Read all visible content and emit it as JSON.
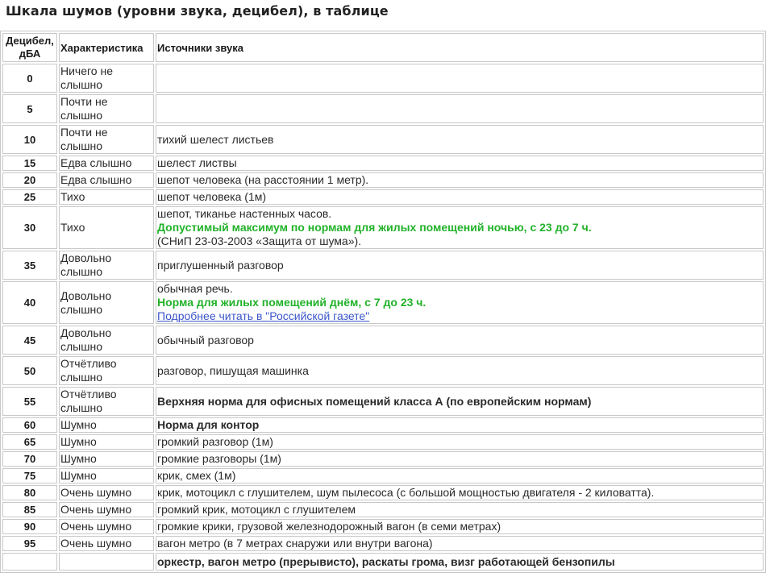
{
  "page": {
    "title": "Шкала шумов (уровни звука, децибел), в таблице"
  },
  "table": {
    "headers": {
      "decibel": "Децибел, дБА",
      "characteristic": "Характеристика",
      "sources": "Источники звука"
    },
    "rows": [
      {
        "db": "0",
        "char": "Ничего не слышно",
        "src": ""
      },
      {
        "db": "5",
        "char": "Почти не слышно",
        "src": ""
      },
      {
        "db": "10",
        "char": "Почти не слышно",
        "src": "тихий шелест листьев"
      },
      {
        "db": "15",
        "char": "Едва слышно",
        "src": "шелест листвы"
      },
      {
        "db": "20",
        "char": "Едва слышно",
        "src": "шепот человека (на расстоянии 1 метр)."
      },
      {
        "db": "25",
        "char": "Тихо",
        "src": "шепот человека (1м)"
      },
      {
        "db": "30",
        "char": "Тихо",
        "src": "шепот, тиканье настенных часов.",
        "norm": "Допустимый максимум по нормам для жилых помещений ночью, с 23 до 7 ч.",
        "note": "(СНиП 23-03-2003 «Защита от шума»)."
      },
      {
        "db": "35",
        "char": "Довольно слышно",
        "src": "приглушенный разговор"
      },
      {
        "db": "40",
        "char": "Довольно слышно",
        "src": "обычная речь.",
        "norm": "Норма для жилых помещений днём, с 7 до 23 ч.",
        "link": "Подробнее читать в \"Российской газете\""
      },
      {
        "db": "45",
        "char": "Довольно слышно",
        "src": "обычный разговор"
      },
      {
        "db": "50",
        "char": "Отчётливо слышно",
        "src": "разговор, пишущая машинка"
      },
      {
        "db": "55",
        "char": "Отчётливо слышно",
        "norm": "Верхняя норма для офисных помещений класса А (по европейским нормам)"
      },
      {
        "db": "60",
        "char": "Шумно",
        "norm": "Норма для контор"
      },
      {
        "db": "65",
        "char": "Шумно",
        "src": "громкий разговор (1м)"
      },
      {
        "db": "70",
        "char": "Шумно",
        "src": "громкие разговоры (1м)"
      },
      {
        "db": "75",
        "char": "Шумно",
        "src": "крик, смех (1м)"
      },
      {
        "db": "80",
        "char": "Очень шумно",
        "src": "крик, мотоцикл с глушителем, шум пылесоса (с большой мощностью двигателя - 2 киловатта)."
      },
      {
        "db": "85",
        "char": "Очень шумно",
        "src": "громкий крик, мотоцикл с глушителем"
      },
      {
        "db": "90",
        "char": "Очень шумно",
        "src": "громкие крики, грузовой железнодорожный вагон (в семи метрах)"
      },
      {
        "db": "95",
        "char": "Очень шумно",
        "src": "вагон метро (в 7 метрах снаружи или внутри вагона)"
      },
      {
        "db": "",
        "char": "",
        "warn": "оркестр, вагон метро (прерывисто), раскаты грома, визг работающей бензопилы"
      }
    ]
  },
  "colors": {
    "norm_green": "#22b22a",
    "warn_orange": "#f07820",
    "link_blue": "#3a55c8",
    "border": "#c8c8c8"
  }
}
